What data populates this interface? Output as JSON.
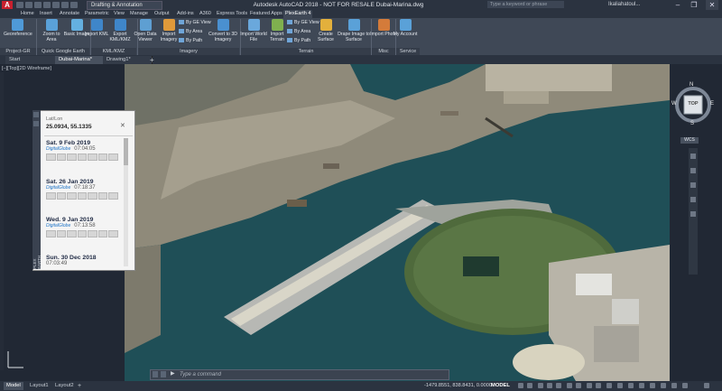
{
  "window": {
    "app_logo": "A",
    "workspace": "Drafting & Annotation",
    "title": "Autodesk AutoCAD 2018 - NOT FOR RESALE    Dubai-Marina.dwg",
    "search_placeholder": "Type a keyword or phrase",
    "user": "Ikaliahatoul...",
    "minimize": "–",
    "restore": "❐",
    "close": "✕"
  },
  "ribbon_tabs": [
    "Home",
    "Insert",
    "Annotate",
    "Parametric",
    "View",
    "Manage",
    "Output",
    "Add-ins",
    "A360",
    "Express Tools",
    "Featured Apps",
    "PlexEarth 4"
  ],
  "active_tab_index": 11,
  "ribbon": {
    "project_gr": {
      "geo_reference": "Georeference",
      "panel": "Project-GR"
    },
    "quick_google_earth": {
      "zoom_to_area": "Zoom to Area",
      "basic_image": "Basic Image",
      "panel": "Quick Google Earth"
    },
    "kml_kmz": {
      "import_kml": "Import KML",
      "export_kml": "Export KML/KMZ",
      "panel": "KML/KMZ"
    },
    "imagery": {
      "open_data_viewer": "Open Data Viewer",
      "import_imagery": "Import Imagery",
      "by_ge_view": "By GE View",
      "by_area": "By Area",
      "by_path": "By Path",
      "convert_3d": "Convert to 3D Imagery",
      "panel": "Imagery"
    },
    "terrain": {
      "import_world_file": "Import World File",
      "import_terrain": "Import Terrain",
      "by_ge_view": "By GE View",
      "by_area": "By Area",
      "by_path": "By Path",
      "create_surface": "Create Surface",
      "drape_image": "Drape Image to Surface",
      "panel": "Terrain"
    },
    "misc": {
      "import_photo": "Import Photo",
      "panel": "Misc"
    },
    "service": {
      "my_account": "My Account",
      "panel": "Service"
    }
  },
  "file_tabs": [
    "Start",
    "Dubai-Marina*",
    "Drawing1*"
  ],
  "active_file_tab": 1,
  "viewport_label": "[–][Top][2D Wireframe]",
  "plugin": {
    "header_label": "Lat/Lon",
    "coordinates": "25.0934, 55.1335",
    "close": "✕",
    "vertical_label": "PLEX EARTH",
    "entries": [
      {
        "date": "Sat. 9 Feb 2019",
        "time": "07:04:05",
        "provider": "DigitalGlobe"
      },
      {
        "date": "Sat. 26 Jan 2019",
        "time": "07:18:37",
        "provider": "DigitalGlobe"
      },
      {
        "date": "Wed. 9 Jan 2019",
        "time": "07:13:58",
        "provider": "DigitalGlobe"
      },
      {
        "date": "Sun. 30 Dec 2018",
        "time": "07:03:49",
        "provider": ""
      }
    ]
  },
  "viewcube": {
    "top": "TOP",
    "north": "N",
    "south": "S",
    "east": "E",
    "west": "W",
    "wcs": "WCS"
  },
  "command": {
    "prompt": "Type a command"
  },
  "status": {
    "layout_tabs": [
      "Model",
      "Layout1",
      "Layout2"
    ],
    "active_layout": 0,
    "coordinates": "-1479.8551, 838.8431, 0.0000",
    "model": "MODEL"
  },
  "colors": {
    "accent": "#c8202e",
    "ribbon": "#3f4856",
    "water": "#1f4f57",
    "land": "#8f8a7a"
  }
}
